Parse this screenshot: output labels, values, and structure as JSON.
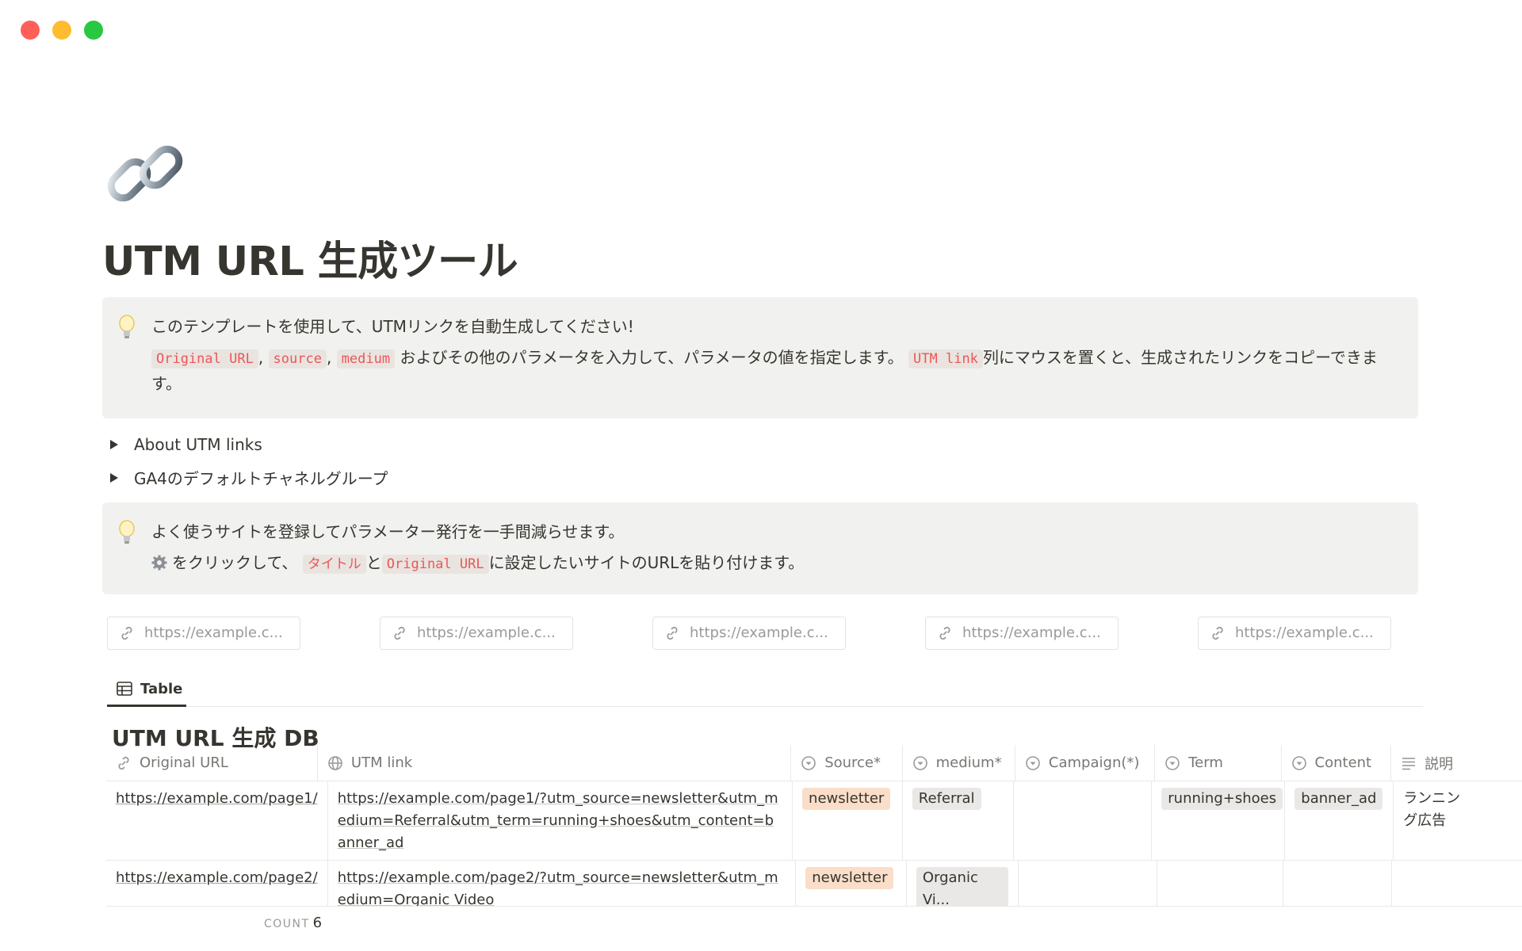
{
  "page": {
    "title": "UTM URL 生成ツール",
    "icon": "link-icon"
  },
  "callout1": {
    "line1": "このテンプレートを使用して、UTMリンクを自動生成してください!",
    "code_original_url": "Original URL",
    "sep1": ",",
    "code_source": "source",
    "sep2": ",",
    "code_medium": "medium",
    "text_mid": "およびその他のパラメータを入力して、パラメータの値を指定します。",
    "code_utm_link": "UTM link",
    "text_end": "列にマウスを置くと、生成されたリンクをコピーできます。"
  },
  "toggles": [
    {
      "label": "About UTM links"
    },
    {
      "label": "GA4のデフォルトチャネルグループ"
    }
  ],
  "callout2": {
    "line1": "よく使うサイトを登録してパラメーター発行を一手間減らせます。",
    "text_a": "をクリックして、",
    "code_title": "タイトル",
    "text_b": "と",
    "code_original_url": "Original URL",
    "text_c": "に設定したいサイトのURLを貼り付けます。"
  },
  "bookmarks": [
    {
      "label": "https://example.c..."
    },
    {
      "label": "https://example.c..."
    },
    {
      "label": "https://example.c..."
    },
    {
      "label": "https://example.c..."
    },
    {
      "label": "https://example.c..."
    }
  ],
  "view_tab": {
    "label": "Table"
  },
  "database": {
    "title": "UTM URL 生成 DB",
    "columns": [
      {
        "label": "Original URL",
        "icon": "link-icon"
      },
      {
        "label": "UTM link",
        "icon": "globe-icon"
      },
      {
        "label": "Source*",
        "icon": "select-icon"
      },
      {
        "label": "medium*",
        "icon": "select-icon"
      },
      {
        "label": "Campaign(*)",
        "icon": "select-icon"
      },
      {
        "label": "Term",
        "icon": "select-icon"
      },
      {
        "label": "Content",
        "icon": "select-icon"
      },
      {
        "label": "説明",
        "icon": "text-lines-icon"
      }
    ],
    "rows": [
      {
        "original_url": "https://example.com/page1/",
        "utm_link": "https://example.com/page1/?utm_source=newsletter&utm_medium=Referral&utm_term=running+shoes&utm_content=banner_ad",
        "source": "newsletter",
        "medium": "Referral",
        "campaign": "",
        "term": "running+shoes",
        "content": "banner_ad",
        "description": "ランニング広告"
      },
      {
        "original_url": "https://example.com/page2/",
        "utm_link": "https://example.com/page2/?utm_source=newsletter&utm_medium=Organic Video",
        "source": "newsletter",
        "medium": "Organic Vi...",
        "campaign": "",
        "term": "",
        "content": "",
        "description": ""
      }
    ],
    "count_label": "COUNT",
    "count_value": "6"
  },
  "colors": {
    "code_text": "#eb5757",
    "callout_bg": "#f1f1ef",
    "pill_orange": "#fadec9",
    "pill_gray": "#e9e8e6"
  }
}
